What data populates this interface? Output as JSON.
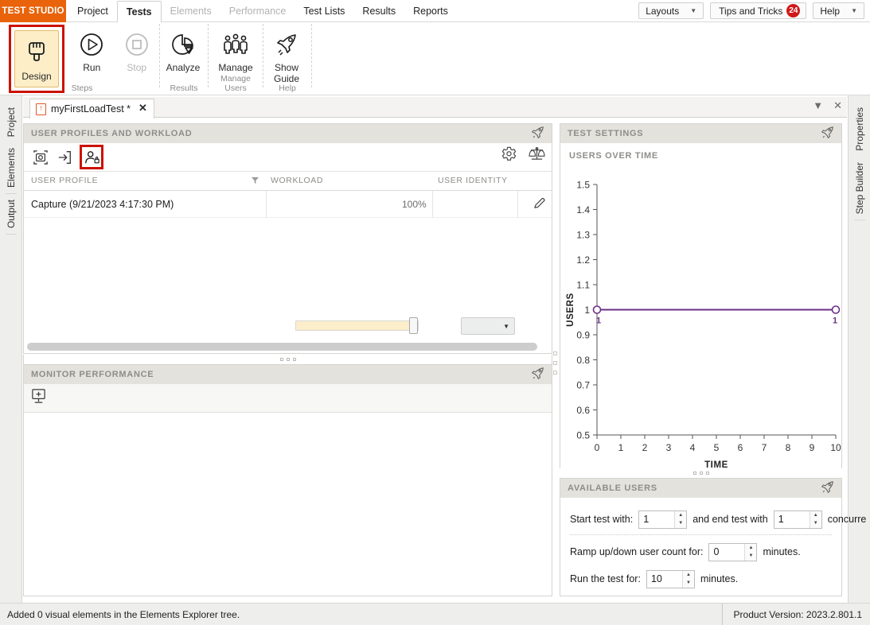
{
  "app": {
    "brand": "TEST STUDIO",
    "menu": [
      {
        "label": "Project",
        "state": "normal"
      },
      {
        "label": "Tests",
        "state": "active"
      },
      {
        "label": "Elements",
        "state": "dim"
      },
      {
        "label": "Performance",
        "state": "dim"
      },
      {
        "label": "Test Lists",
        "state": "normal"
      },
      {
        "label": "Results",
        "state": "normal"
      },
      {
        "label": "Reports",
        "state": "normal"
      }
    ],
    "top_right": {
      "layouts_label": "Layouts",
      "tips_label": "Tips and Tricks",
      "tips_badge": "24",
      "help_label": "Help",
      "caret": "▼"
    }
  },
  "ribbon": {
    "groups": [
      {
        "label": "Steps",
        "buttons": [
          {
            "label": "Design",
            "icon": "paint-brush-icon",
            "state": "selected"
          },
          {
            "label": "Run",
            "icon": "play-circle-icon",
            "state": "normal"
          },
          {
            "label": "Stop",
            "icon": "stop-circle-icon",
            "state": "disabled"
          }
        ]
      },
      {
        "label": "Results",
        "buttons": [
          {
            "label": "Analyze",
            "icon": "pie-chart-icon",
            "state": "normal"
          }
        ]
      },
      {
        "label": "Manage Users",
        "buttons": [
          {
            "label": "Manage",
            "icon": "users-group-icon",
            "state": "normal"
          }
        ]
      },
      {
        "label": "Help",
        "buttons": [
          {
            "label": "Show Guide",
            "icon": "rocket-icon",
            "state": "normal"
          }
        ]
      }
    ]
  },
  "side_tabs": {
    "left": [
      "Project",
      "Elements",
      "Output"
    ],
    "right": [
      "Properties",
      "Step Builder"
    ]
  },
  "tabstrip": {
    "document_tab": "myFirstLoadTest *",
    "close_label": "✕",
    "tools": [
      "▼",
      "✕"
    ]
  },
  "profiles_panel": {
    "title": "USER PROFILES AND WORKLOAD",
    "toolbar_icons": [
      "capture-profile-icon",
      "import-profile-icon",
      "user-identity-icon"
    ],
    "toolbar_right_icons": [
      "gear-icon",
      "balance-scale-icon"
    ],
    "columns": [
      "USER PROFILE",
      "WORKLOAD",
      "USER IDENTITY"
    ],
    "filter_icon": "filter-icon",
    "rows": [
      {
        "profile": "Capture (9/21/2023 4:17:30 PM)",
        "workload_percent": "100%",
        "workload_value": 100,
        "identity": "",
        "edit_icon": "pencil-icon",
        "delete_icon": "trash-icon"
      }
    ]
  },
  "monitor_panel": {
    "title": "MONITOR PERFORMANCE",
    "add_icon": "monitor-add-icon"
  },
  "settings_panel": {
    "title": "TEST SETTINGS",
    "chart_heading": "USERS OVER TIME"
  },
  "available_panel": {
    "title": "AVAILABLE USERS",
    "start_label": "Start test with:",
    "start_value": "1",
    "end_label": "and end test with",
    "end_value": "1",
    "concurrent_label": "concurre",
    "ramp_label": "Ramp up/down user count for:",
    "ramp_value": "0",
    "ramp_unit": "minutes.",
    "run_label": "Run the test for:",
    "run_value": "10",
    "run_unit": "minutes."
  },
  "statusbar": {
    "message": "Added 0 visual elements in the Elements Explorer tree.",
    "version": "Product Version: 2023.2.801.1"
  },
  "colors": {
    "brand_orange": "#e8630a",
    "highlight_red": "#cc1100",
    "badge_red": "#d01919",
    "selected_fill": "#fdeec8",
    "chart_line": "#6b2f87"
  },
  "chart_data": {
    "type": "line",
    "title": "USERS OVER TIME",
    "xlabel": "TIME",
    "ylabel": "USERS",
    "xlim": [
      0,
      10
    ],
    "ylim": [
      0.5,
      1.5
    ],
    "xticks": [
      0,
      1,
      2,
      3,
      4,
      5,
      6,
      7,
      8,
      9,
      10
    ],
    "yticks": [
      "0.5",
      "0.6",
      "0.7",
      "0.8",
      "0.9",
      "1",
      "1.1",
      "1.2",
      "1.3",
      "1.4",
      "1.5"
    ],
    "grid": false,
    "legend": "none",
    "series": [
      {
        "name": "Users",
        "color": "#6b2f87",
        "x": [
          0,
          10
        ],
        "y": [
          1,
          1
        ],
        "point_labels": [
          "1",
          "1"
        ],
        "markers": "open-circle"
      }
    ]
  }
}
